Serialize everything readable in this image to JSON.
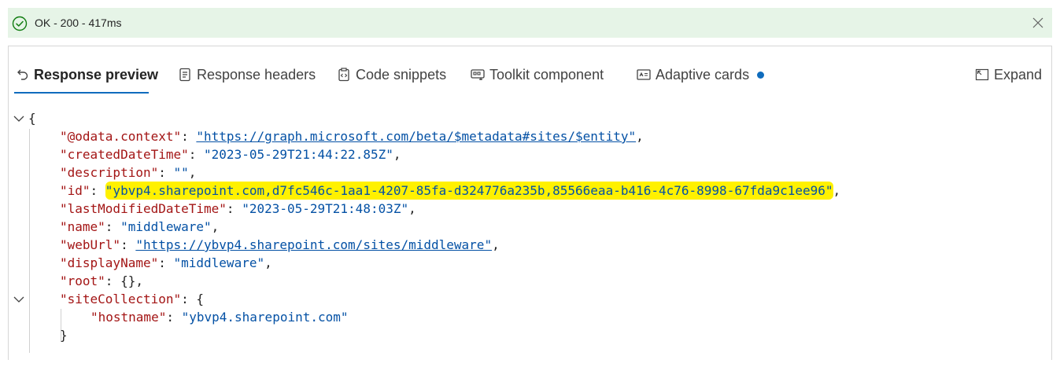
{
  "status": {
    "text": "OK - 200 - 417ms",
    "icon": "check-circle-icon",
    "close_icon": "close-icon",
    "color": "#e6f4e7"
  },
  "tabs": [
    {
      "label": "Response preview",
      "icon": "undo-arrow-icon",
      "active": true
    },
    {
      "label": "Response headers",
      "icon": "document-list-icon"
    },
    {
      "label": "Code snippets",
      "icon": "code-clipboard-icon"
    },
    {
      "label": "Toolkit component",
      "icon": "toolkit-icon"
    },
    {
      "label": "Adaptive cards",
      "icon": "card-icon",
      "has_dot": true
    },
    {
      "label": "Expand",
      "icon": "expand-icon"
    }
  ],
  "accent_color": "#0f6cbd",
  "highlight_color": "#fff100",
  "json": {
    "open_brace": "{",
    "close_inner": "}",
    "rows": [
      {
        "key": "\"@odata.context\"",
        "value": "\"https://graph.microsoft.com/beta/$metadata#sites/$entity\"",
        "trail": ","
      },
      {
        "key": "\"createdDateTime\"",
        "value": "\"2023-05-29T21:44:22.85Z\"",
        "trail": ","
      },
      {
        "key": "\"description\"",
        "value": "\"\"",
        "trail": ","
      },
      {
        "key": "\"id\"",
        "value": "\"ybvp4.sharepoint.com,d7fc546c-1aa1-4207-85fa-d324776a235b,85566eaa-b416-4c76-8998-67fda9c1ee96\"",
        "trail": ","
      },
      {
        "key": "\"lastModifiedDateTime\"",
        "value": "\"2023-05-29T21:48:03Z\"",
        "trail": ","
      },
      {
        "key": "\"name\"",
        "value": "\"middleware\"",
        "trail": ","
      },
      {
        "key": "\"webUrl\"",
        "value": "\"https://ybvp4.sharepoint.com/sites/middleware\"",
        "trail": ","
      },
      {
        "key": "\"displayName\"",
        "value": "\"middleware\"",
        "trail": ","
      },
      {
        "key": "\"root\"",
        "value": "{}",
        "trail": ","
      },
      {
        "key": "\"siteCollection\"",
        "value": "{",
        "trail": ""
      },
      {
        "key": "\"hostname\"",
        "value": "\"ybvp4.sharepoint.com\"",
        "trail": ""
      }
    ]
  }
}
